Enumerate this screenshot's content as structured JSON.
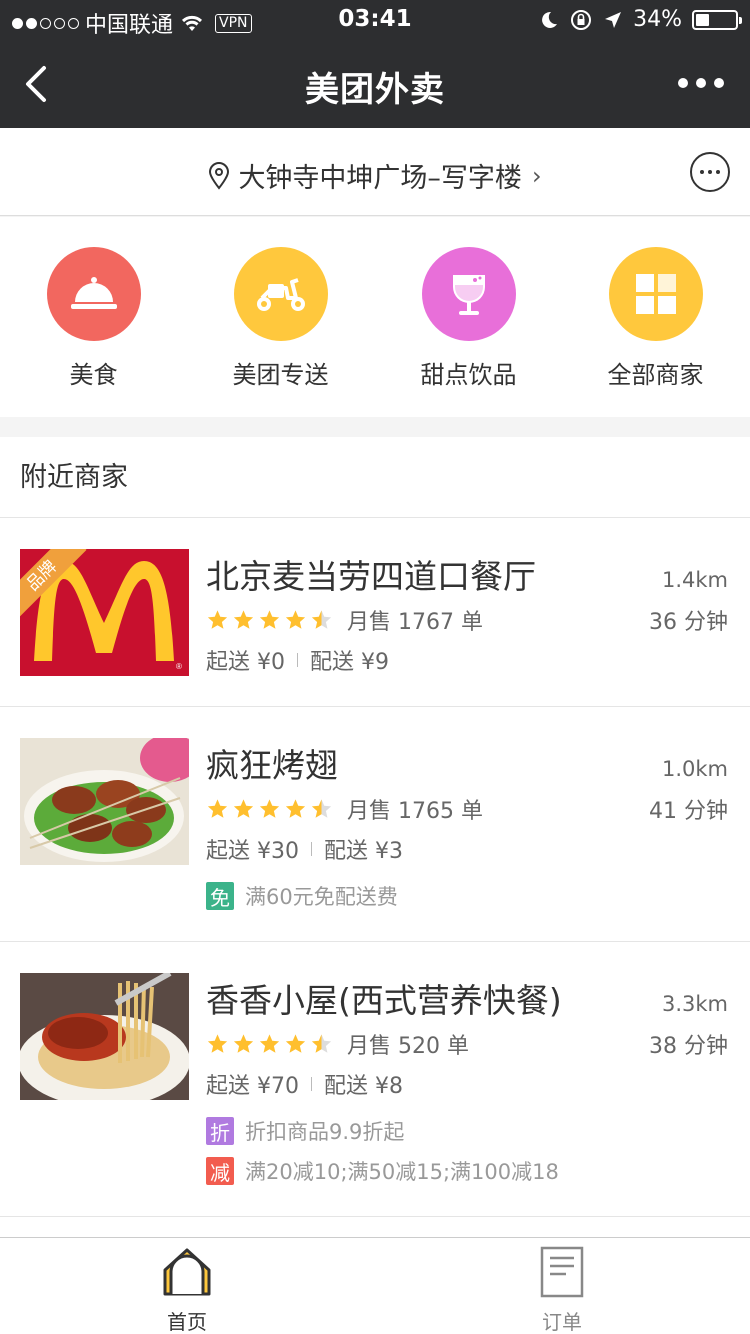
{
  "status_bar": {
    "carrier": "中国联通",
    "vpn": "VPN",
    "time": "03:41",
    "battery": "34%",
    "battery_level": 0.34
  },
  "nav": {
    "title": "美团外卖"
  },
  "location": {
    "address": "大钟寺中坤广场–写字楼",
    "chevron": "›"
  },
  "categories": [
    {
      "label": "美食",
      "icon": "food-cloche-icon",
      "color": "#f2675f"
    },
    {
      "label": "美团专送",
      "icon": "scooter-icon",
      "color": "#ffc83d"
    },
    {
      "label": "甜点饮品",
      "icon": "drink-glass-icon",
      "color": "#e86fd9"
    },
    {
      "label": "全部商家",
      "icon": "grid-icon",
      "color": "#ffc83d"
    }
  ],
  "nearby": {
    "heading": "附近商家",
    "shops": [
      {
        "name": "北京麦当劳四道口餐厅",
        "rating": 4.5,
        "sales": "月售 1767 单",
        "min_order": "起送 ¥0",
        "delivery_fee": "配送 ¥9",
        "distance": "1.4km",
        "time": "36 分钟",
        "brand_badge": "品牌",
        "promos": []
      },
      {
        "name": "疯狂烤翅",
        "rating": 4.5,
        "sales": "月售 1765 单",
        "min_order": "起送 ¥30",
        "delivery_fee": "配送 ¥3",
        "distance": "1.0km",
        "time": "41 分钟",
        "promos": [
          {
            "tag": "免",
            "text": "满60元免配送费",
            "color": "#3bb38a"
          }
        ]
      },
      {
        "name": "香香小屋(西式营养快餐)",
        "rating": 4.5,
        "sales": "月售 520 单",
        "min_order": "起送 ¥70",
        "delivery_fee": "配送 ¥8",
        "distance": "3.3km",
        "time": "38 分钟",
        "promos": [
          {
            "tag": "折",
            "text": "折扣商品9.9折起",
            "color": "#b07ae0"
          },
          {
            "tag": "减",
            "text": "满20减10;满50减15;满100减18",
            "color": "#f25c4f"
          }
        ]
      }
    ]
  },
  "tabbar": {
    "home": "首页",
    "orders": "订单"
  },
  "colors": {
    "nav_bg": "#2d2e30",
    "star": "#ffbf2e",
    "home_active": "#ffc83d"
  }
}
